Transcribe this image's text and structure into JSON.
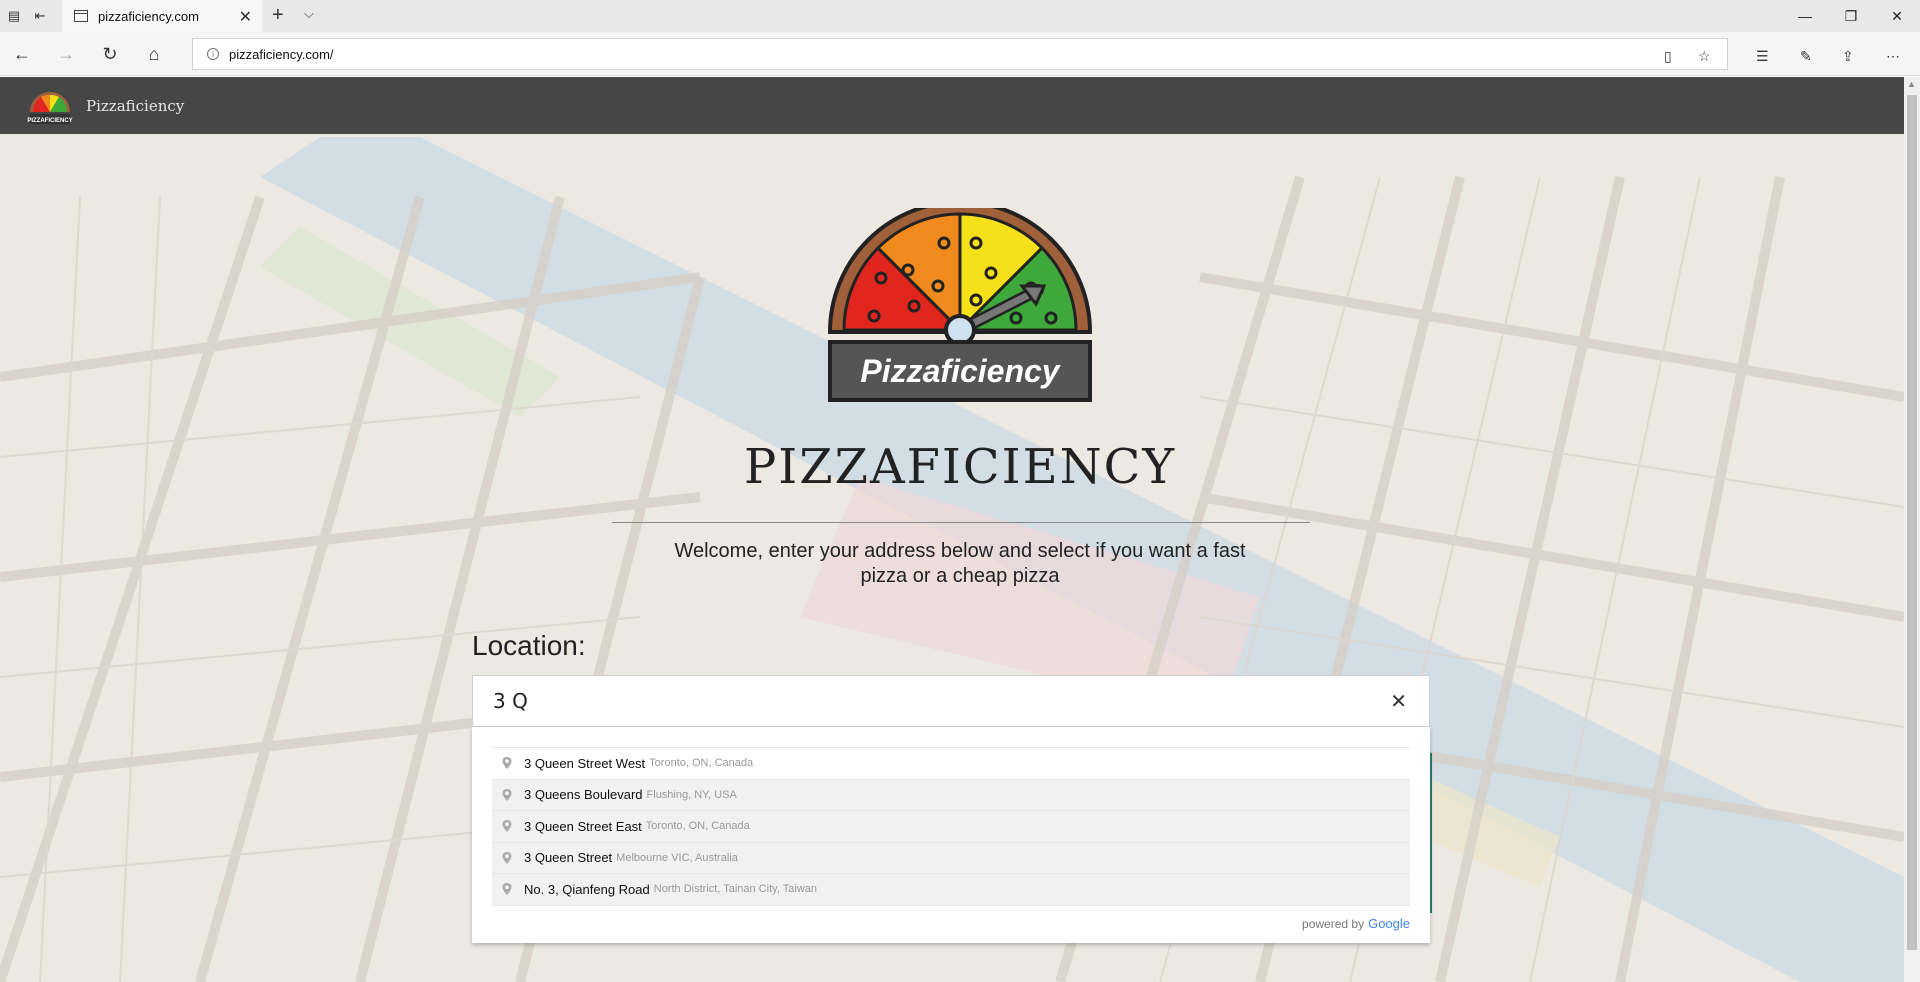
{
  "browser": {
    "tab_title": "pizzaficiency.com",
    "url": "pizzaficiency.com/"
  },
  "site": {
    "brand_name": "Pizzaficiency",
    "logo_text": "Pizzaficiency",
    "small_logo_text": "PIZZAFICIENCY",
    "title": "PIZZAFICIENCY",
    "subtitle": "Welcome, enter your address below and select if you want a fast pizza or a cheap pizza",
    "location_label": "Location:",
    "location_value": "3 Q",
    "clear_symbol": "✕"
  },
  "suggestions": [
    {
      "main": "3 Queen Street West",
      "secondary": "Toronto, ON, Canada"
    },
    {
      "main": "3 Queens Boulevard",
      "secondary": "Flushing, NY, USA"
    },
    {
      "main": "3 Queen Street East",
      "secondary": "Toronto, ON, Canada"
    },
    {
      "main": "3 Queen Street",
      "secondary": "Melbourne VIC, Australia"
    },
    {
      "main": "No. 3, Qianfeng Road",
      "secondary": "North District, Tainan City, Taiwan"
    }
  ],
  "attribution": {
    "powered_by": "powered by",
    "provider": "Google"
  },
  "colors": {
    "header_bar": "#464646",
    "pizza_red": "#e0261f",
    "pizza_orange": "#f08a1c",
    "pizza_yellow": "#f5e11a",
    "pizza_green": "#3ea83a",
    "crust": "#a0613a",
    "logo_plate": "#555555"
  }
}
